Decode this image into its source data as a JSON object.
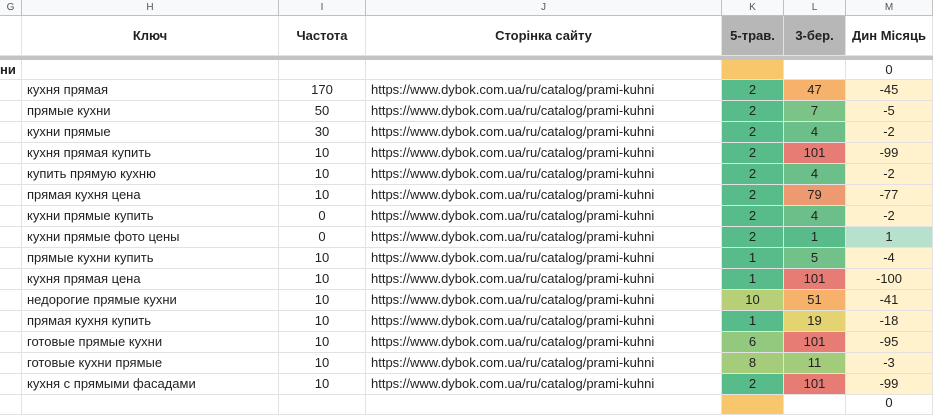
{
  "column_letters": [
    "G",
    "H",
    "I",
    "J",
    "K",
    "L",
    "M"
  ],
  "headers": {
    "key": "Ключ",
    "frequency": "Частота",
    "page": "Сторінка сайту",
    "k_date": "5-трав.",
    "l_date": "3-бер.",
    "m_dyn": "Дин Місяць"
  },
  "group_row": {
    "g_text": "ни",
    "m_value": "0"
  },
  "colors": {
    "dark_green": "#57bb8a",
    "mid_green": "#7bc387",
    "light_green": "#93c97f",
    "yellow_green": "#b7d077",
    "yellow": "#e4d471",
    "orange": "#f6b26b",
    "red": "#e67c73",
    "pale_yellow": "#fff2cc",
    "pale_green": "#b7e1cd",
    "k_orange": "#f9c76b"
  },
  "rows": [
    {
      "key": "кухня прямая",
      "freq": "170",
      "url": "https://www.dybok.com.ua/ru/catalog/prami-kuhni",
      "k": "2",
      "l": "47",
      "m": "-45",
      "kc": "#57bb8a",
      "lc": "#f6b26b",
      "mc": "#fff2cc"
    },
    {
      "key": "прямые кухни",
      "freq": "50",
      "url": "https://www.dybok.com.ua/ru/catalog/prami-kuhni",
      "k": "2",
      "l": "7",
      "m": "-5",
      "kc": "#57bb8a",
      "lc": "#7bc387",
      "mc": "#fff2cc"
    },
    {
      "key": "кухни прямые",
      "freq": "30",
      "url": "https://www.dybok.com.ua/ru/catalog/prami-kuhni",
      "k": "2",
      "l": "4",
      "m": "-2",
      "kc": "#57bb8a",
      "lc": "#6cbf88",
      "mc": "#fff2cc"
    },
    {
      "key": "кухня прямая купить",
      "freq": "10",
      "url": "https://www.dybok.com.ua/ru/catalog/prami-kuhni",
      "k": "2",
      "l": "101",
      "m": "-99",
      "kc": "#57bb8a",
      "lc": "#e67c73",
      "mc": "#fff2cc"
    },
    {
      "key": "купить прямую кухню",
      "freq": "10",
      "url": "https://www.dybok.com.ua/ru/catalog/prami-kuhni",
      "k": "2",
      "l": "4",
      "m": "-2",
      "kc": "#57bb8a",
      "lc": "#6cbf88",
      "mc": "#fff2cc"
    },
    {
      "key": "прямая кухня цена",
      "freq": "10",
      "url": "https://www.dybok.com.ua/ru/catalog/prami-kuhni",
      "k": "2",
      "l": "79",
      "m": "-77",
      "kc": "#57bb8a",
      "lc": "#ee9a70",
      "mc": "#fff2cc"
    },
    {
      "key": "кухни прямые купить",
      "freq": "0",
      "url": "https://www.dybok.com.ua/ru/catalog/prami-kuhni",
      "k": "2",
      "l": "4",
      "m": "-2",
      "kc": "#57bb8a",
      "lc": "#6cbf88",
      "mc": "#fff2cc"
    },
    {
      "key": "кухни прямые фото цены",
      "freq": "0",
      "url": "https://www.dybok.com.ua/ru/catalog/prami-kuhni",
      "k": "2",
      "l": "1",
      "m": "1",
      "kc": "#57bb8a",
      "lc": "#57bb8a",
      "mc": "#b7e1cd"
    },
    {
      "key": "прямые кухни купить",
      "freq": "10",
      "url": "https://www.dybok.com.ua/ru/catalog/prami-kuhni",
      "k": "1",
      "l": "5",
      "m": "-4",
      "kc": "#57bb8a",
      "lc": "#72c188",
      "mc": "#fff2cc"
    },
    {
      "key": "кухня прямая цена",
      "freq": "10",
      "url": "https://www.dybok.com.ua/ru/catalog/prami-kuhni",
      "k": "1",
      "l": "101",
      "m": "-100",
      "kc": "#57bb8a",
      "lc": "#e67c73",
      "mc": "#fff2cc"
    },
    {
      "key": "недорогие прямые кухни",
      "freq": "10",
      "url": "https://www.dybok.com.ua/ru/catalog/prami-kuhni",
      "k": "10",
      "l": "51",
      "m": "-41",
      "kc": "#b7d077",
      "lc": "#f6b26b",
      "mc": "#fff2cc"
    },
    {
      "key": "прямая кухня купить",
      "freq": "10",
      "url": "https://www.dybok.com.ua/ru/catalog/prami-kuhni",
      "k": "1",
      "l": "19",
      "m": "-18",
      "kc": "#57bb8a",
      "lc": "#e4d471",
      "mc": "#fff2cc"
    },
    {
      "key": "готовые прямые кухни",
      "freq": "10",
      "url": "https://www.dybok.com.ua/ru/catalog/prami-kuhni",
      "k": "6",
      "l": "101",
      "m": "-95",
      "kc": "#93c97f",
      "lc": "#e67c73",
      "mc": "#fff2cc"
    },
    {
      "key": "готовые кухни прямые",
      "freq": "10",
      "url": "https://www.dybok.com.ua/ru/catalog/prami-kuhni",
      "k": "8",
      "l": "11",
      "m": "-3",
      "kc": "#a5cc7b",
      "lc": "#a3cb7c",
      "mc": "#fff2cc"
    },
    {
      "key": "кухня с прямыми фасадами",
      "freq": "10",
      "url": "https://www.dybok.com.ua/ru/catalog/prami-kuhni",
      "k": "2",
      "l": "101",
      "m": "-99",
      "kc": "#57bb8a",
      "lc": "#e67c73",
      "mc": "#fff2cc"
    }
  ],
  "trailing_row": {
    "m_value": "0"
  }
}
